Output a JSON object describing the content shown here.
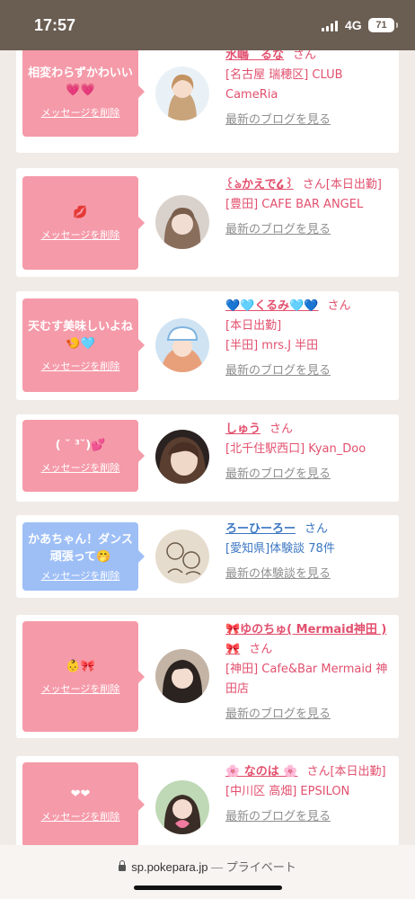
{
  "status": {
    "time": "17:57",
    "network": "4G",
    "battery": "71"
  },
  "delete_label": "メッセージを削除",
  "san": "さん",
  "cards": [
    {
      "message": "相変わらずかわいい💗💗",
      "name": "水嶋　るな",
      "line1": "[名古屋 瑞穂区] CLUB CameRia",
      "line2": "",
      "link": "最新のブログを見る"
    },
    {
      "message": "💋",
      "name": "꒰ঌかえで໒꒱",
      "line1": "[本日出勤]",
      "line2": "[豊田] CAFE BAR ANGEL",
      "link": "最新のブログを見る"
    },
    {
      "message": "天むす美味しいよね🍤🩵",
      "name": "💙🩵くるみ🩵💙",
      "line1": "[本日出勤]",
      "line2": "[半田] mrs.J 半田",
      "link": "最新のブログを見る"
    },
    {
      "message": "( ˘ ³˘)💕",
      "name": "しゅう",
      "line1": "[北千住駅西口] Kyan_Doo",
      "line2": "",
      "link": "最新のブログを見る"
    },
    {
      "message": "かあちゃん！ダンス頑張って🤭",
      "name": "ろーひーろー",
      "line1": "[愛知県]体験談 78件",
      "line2": "",
      "link": "最新の体験談を見る"
    },
    {
      "message": "👶🎀",
      "name": "🎀ゆのちゅ( Mermaid神田 )🎀",
      "line1": "[神田] Cafe&Bar Mermaid 神田店",
      "line2": "",
      "link": "最新のブログを見る"
    },
    {
      "message": "❤︎❤︎",
      "name": "🌸 なのは 🌸",
      "line1": "[本日出勤]",
      "line2": "[中川区 高畑] EPSILON",
      "link": "最新のブログを見る"
    }
  ],
  "url_bar": {
    "domain": "sp.pokepara.jp",
    "separator": " — ",
    "mode": "プライベート"
  }
}
